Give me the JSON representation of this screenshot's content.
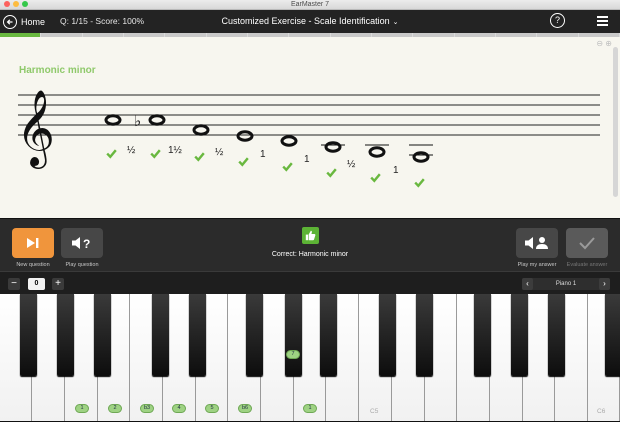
{
  "window": {
    "title": "EarMaster 7"
  },
  "header": {
    "home_label": "Home",
    "question_score": "Q: 1/15 - Score: 100%",
    "exercise_title": "Customized Exercise - Scale Identification",
    "help_symbol": "?",
    "icons": {
      "home": "arrow-left-circle-icon",
      "help": "question-circle-icon",
      "menu": "hamburger-menu-icon"
    }
  },
  "progress": {
    "total_segments": 15,
    "completed": 1,
    "accent": "#69b83f"
  },
  "staff": {
    "scale_name": "Harmonic minor",
    "scale_color": "#8fc96b",
    "intervals": [
      "½",
      "1½",
      "½",
      "1",
      "1",
      "½",
      "1"
    ]
  },
  "controls": {
    "new_question_label": "New question",
    "play_question_label": "Play question",
    "play_my_answer_label": "Play my answer",
    "evaluate_label": "Evaluate answer",
    "result_text": "Correct: Harmonic minor",
    "accent_orange": "#f0953c",
    "correct_green": "#5cb335"
  },
  "keyboard_toolbar": {
    "minus": "−",
    "octave_value": "0",
    "plus": "+",
    "instrument": "Piano 1",
    "prev": "‹",
    "next": "›"
  },
  "keyboard": {
    "white_tags": [
      "1",
      "2",
      "b3",
      "4",
      "5",
      "b6",
      "1"
    ],
    "black_tag": "7",
    "c5_label": "C5",
    "c6_label": "C6"
  }
}
